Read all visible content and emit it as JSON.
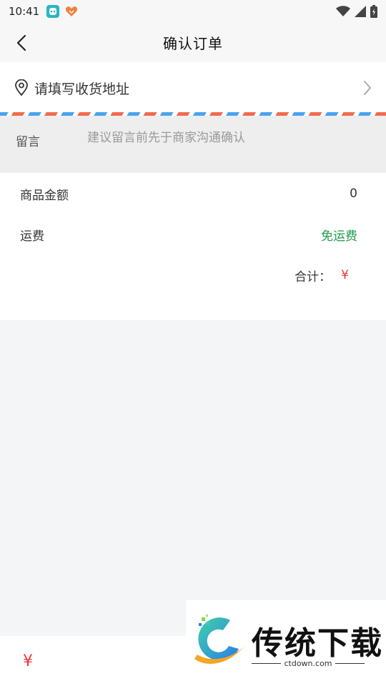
{
  "status_bar": {
    "time": "10:41"
  },
  "header": {
    "title": "确认订单",
    "back_icon": "chevron-left-icon"
  },
  "address": {
    "placeholder_text": "请填写收货地址",
    "icon": "location-pin-icon"
  },
  "message": {
    "label": "留言",
    "placeholder": "建议留言前先于商家沟通确认",
    "value": ""
  },
  "summary": {
    "goods_label": "商品金额",
    "goods_value": "0",
    "shipping_label": "运费",
    "shipping_value": "免运费",
    "total_label": "合计：",
    "total_value": "¥"
  },
  "bottom_bar": {
    "price": "¥"
  },
  "watermark": {
    "title": "传统下载",
    "subtitle": "ctdown.com"
  },
  "colors": {
    "accent_red": "#e53935",
    "shipping_green": "#1f9a4a",
    "stripe_red": "#f26a4f",
    "stripe_blue": "#4aa3f0"
  }
}
